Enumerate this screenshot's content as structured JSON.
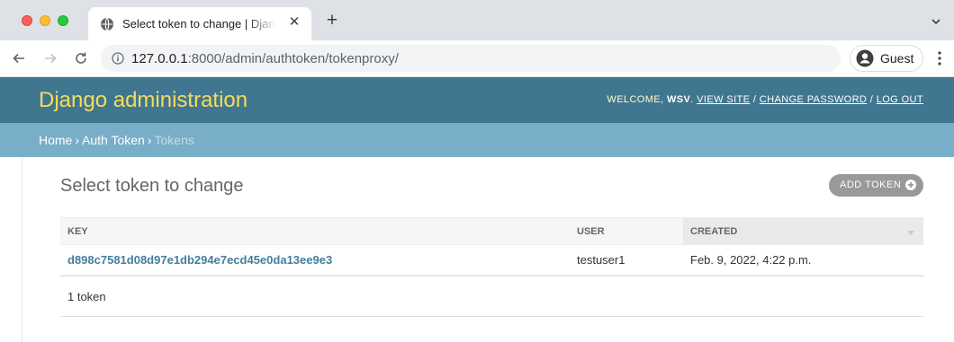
{
  "browser": {
    "tab_title": "Select token to change | Django site admin",
    "url_host": "127.0.0.1",
    "url_rest": ":8000/admin/authtoken/tokenproxy/",
    "profile_label": "Guest",
    "icons": {
      "favicon": "globe-icon",
      "close": "close-icon",
      "new_tab": "plus-icon",
      "tab_menu": "chevron-down-icon",
      "back": "arrow-left-icon",
      "forward": "arrow-right-icon",
      "reload": "reload-icon",
      "site_info": "info-icon",
      "profile": "profile-icon",
      "menu": "kebab-menu-icon"
    }
  },
  "header": {
    "branding": "Django administration",
    "welcome": "WELCOME,",
    "username": "WSV",
    "view_site": "VIEW SITE",
    "change_password": "CHANGE PASSWORD",
    "log_out": "LOG OUT",
    "separator": "/"
  },
  "breadcrumbs": {
    "home": "Home",
    "app": "Auth Token",
    "current": "Tokens",
    "separator": "›"
  },
  "content": {
    "title": "Select token to change",
    "add_button": "ADD TOKEN",
    "table": {
      "columns": [
        "KEY",
        "USER",
        "CREATED"
      ],
      "rows": [
        {
          "key": "d898c7581d08d97e1db294e7ecd45e0da13ee9e3",
          "user": "testuser1",
          "created": "Feb. 9, 2022, 4:22 p.m."
        }
      ]
    },
    "paginator": "1 token"
  },
  "colors": {
    "header_bg": "#417690",
    "branding": "#f5dd5d",
    "breadcrumbs_bg": "#79aec8",
    "link": "#447e9b",
    "add_button_bg": "#999999"
  }
}
